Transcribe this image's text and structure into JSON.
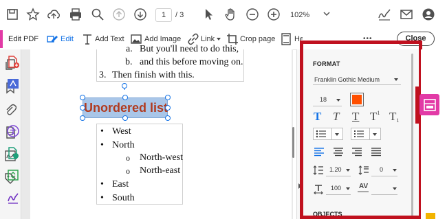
{
  "toolbar": {
    "page_current": "1",
    "page_total": "/ 3",
    "zoom": "102%"
  },
  "edit_toolbar": {
    "title": "Edit PDF",
    "edit": "Edit",
    "add_text": "Add Text",
    "add_image": "Add Image",
    "link": "Link",
    "crop_page": "Crop page",
    "header_footer": "Header & Footer",
    "more": "•••",
    "close": "Close"
  },
  "document": {
    "ordered_lines": [
      {
        "marker": "a.",
        "text": "But you'll need to do this,"
      },
      {
        "marker": "b.",
        "text": "and this before moving on."
      }
    ],
    "step3": {
      "marker": "3.",
      "text": "Then finish with this."
    },
    "heading": "Unordered list",
    "bullets": [
      {
        "level": 1,
        "text": "West"
      },
      {
        "level": 1,
        "text": "North"
      },
      {
        "level": 2,
        "text": "North-west"
      },
      {
        "level": 2,
        "text": "North-east"
      },
      {
        "level": 1,
        "text": "East"
      },
      {
        "level": 1,
        "text": "South"
      }
    ]
  },
  "format_panel": {
    "section_title": "FORMAT",
    "font": "Franklin Gothic Medium",
    "font_size": "18",
    "font_color": "#ff4f00",
    "line_spacing": "1.20",
    "para_spacing": "0",
    "scale": "100",
    "objects_title": "OBJECTS"
  },
  "colors": {
    "accent_blue": "#1473e6",
    "highlight_red": "#c0111f",
    "heading_text": "#b13a1e",
    "selection_fill": "#a9c6e8",
    "active_tool_pink": "#e23aa6"
  }
}
